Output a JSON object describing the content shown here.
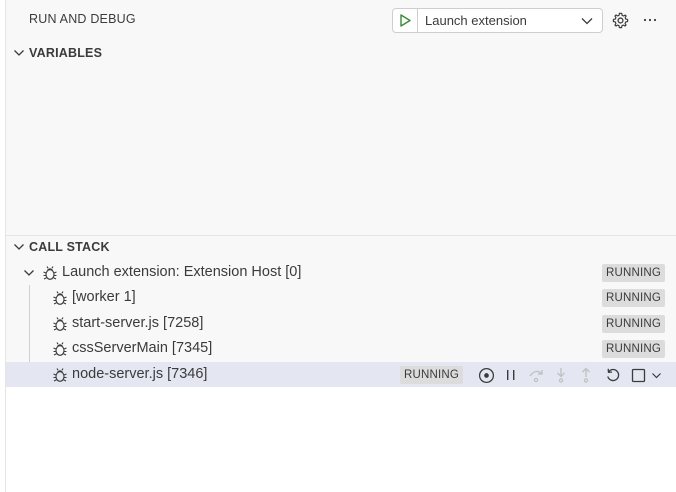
{
  "header": {
    "title": "RUN AND DEBUG",
    "launch_config": "Launch extension",
    "icons": [
      "play-icon",
      "chevron-down-icon",
      "gear-icon",
      "more-icon"
    ]
  },
  "sections": {
    "variables": "VARIABLES",
    "call_stack": "CALL STACK"
  },
  "call_stack": {
    "session": {
      "label": "Launch extension: Extension Host [0]",
      "status": "RUNNING"
    },
    "threads": [
      {
        "label": "[worker 1]",
        "status": "RUNNING"
      },
      {
        "label": "start-server.js [7258]",
        "status": "RUNNING"
      },
      {
        "label": "cssServerMain [7345]",
        "status": "RUNNING"
      },
      {
        "label": "node-server.js [7346]",
        "status": "RUNNING"
      }
    ],
    "toolbar_icons": [
      "focus-session-icon",
      "pause-icon",
      "step-over-icon",
      "step-into-icon",
      "step-out-icon",
      "restart-icon",
      "stop-icon",
      "chevron-down-icon"
    ]
  },
  "colors": {
    "play": "#388a34",
    "selected_row": "#e4e6f1",
    "badge": "#dcdcdc"
  }
}
